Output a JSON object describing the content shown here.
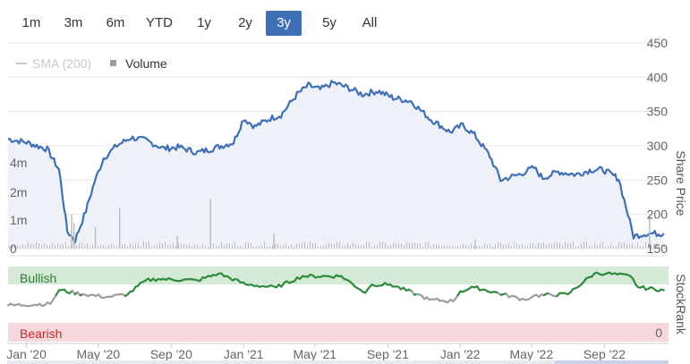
{
  "range_selector": {
    "buttons": [
      {
        "label": "1m",
        "active": false
      },
      {
        "label": "3m",
        "active": false
      },
      {
        "label": "6m",
        "active": false
      },
      {
        "label": "YTD",
        "active": false
      },
      {
        "label": "1y",
        "active": false
      },
      {
        "label": "2y",
        "active": false
      },
      {
        "label": "3y",
        "active": true
      },
      {
        "label": "5y",
        "active": false
      },
      {
        "label": "All",
        "active": false
      }
    ]
  },
  "colors": {
    "price_line": "#3f6fb5",
    "price_fill": "#eef1f8",
    "volume_bar": "#bdbdbd",
    "bullish_band": "#d4ead6",
    "bearish_band": "#f6d7dc",
    "rank_bullish": "#2e8b3e",
    "rank_neutral": "#9e9e9e",
    "active_button": "#3f70b4",
    "sma_legend": "#c8c8c8"
  },
  "chart_data": {
    "type": "line",
    "legend": {
      "placement": "top-left",
      "items": [
        {
          "label": "SMA (200)",
          "color": "#c8c8c8",
          "enabled": false
        },
        {
          "label": "Volume",
          "color": "#9e9e9e",
          "enabled": true
        }
      ]
    },
    "x_axis": {
      "ticks": [
        "Jan '20",
        "May '20",
        "Sep '20",
        "Jan '21",
        "May '21",
        "Sep '21",
        "Jan '22",
        "May '22",
        "Sep '22"
      ],
      "range": [
        "2019-12-01",
        "2022-12-15"
      ]
    },
    "price": {
      "axis_title": "Share Price",
      "axis_side": "right",
      "ylim": [
        150,
        450
      ],
      "ticks": [
        150,
        200,
        250,
        300,
        350,
        400,
        450
      ],
      "series": {
        "x": [
          "2019-12-01",
          "2020-01-01",
          "2020-02-05",
          "2020-02-25",
          "2020-03-10",
          "2020-03-23",
          "2020-04-10",
          "2020-04-25",
          "2020-05-10",
          "2020-06-01",
          "2020-06-25",
          "2020-07-20",
          "2020-08-20",
          "2020-09-15",
          "2020-10-15",
          "2020-11-10",
          "2020-12-15",
          "2021-01-01",
          "2021-01-20",
          "2021-02-15",
          "2021-03-05",
          "2021-04-01",
          "2021-04-20",
          "2021-05-10",
          "2021-06-01",
          "2021-06-25",
          "2021-07-20",
          "2021-08-15",
          "2021-09-10",
          "2021-10-10",
          "2021-11-10",
          "2021-12-15",
          "2022-01-05",
          "2022-01-25",
          "2022-02-20",
          "2022-03-10",
          "2022-04-10",
          "2022-05-05",
          "2022-05-20",
          "2022-06-15",
          "2022-07-15",
          "2022-08-10",
          "2022-08-30",
          "2022-09-25",
          "2022-10-20",
          "2022-11-10",
          "2022-12-10"
        ],
        "y": [
          310,
          305,
          295,
          265,
          175,
          162,
          205,
          248,
          282,
          300,
          312,
          308,
          296,
          298,
          290,
          296,
          305,
          340,
          328,
          340,
          345,
          375,
          388,
          382,
          392,
          385,
          375,
          380,
          370,
          365,
          340,
          320,
          330,
          316,
          285,
          250,
          258,
          268,
          253,
          262,
          258,
          265,
          265,
          252,
          168,
          172,
          172
        ]
      }
    },
    "volume": {
      "axis_side": "left",
      "ylim": [
        0,
        5
      ],
      "ticks": [
        "0",
        "1m",
        "2m",
        "4m"
      ],
      "bars": [
        {
          "x": "2020-03-16",
          "value": 1.6
        },
        {
          "x": "2020-03-20",
          "value": 1.2
        },
        {
          "x": "2020-04-25",
          "value": 1.0
        },
        {
          "x": "2020-06-05",
          "value": 1.9
        },
        {
          "x": "2020-09-10",
          "value": 0.6
        },
        {
          "x": "2020-11-05",
          "value": 2.3
        },
        {
          "x": "2021-02-20",
          "value": 0.7
        },
        {
          "x": "2022-01-25",
          "value": 0.4
        },
        {
          "x": "2022-11-15",
          "value": 1.5
        }
      ]
    },
    "stockrank": {
      "axis_title": "StockRank",
      "axis_side": "right",
      "ylim": [
        0,
        100
      ],
      "ticks": [
        "0"
      ],
      "band_labels": [
        "Bullish",
        "Bearish"
      ],
      "bullish_threshold": 80,
      "series": {
        "x": [
          "2019-12-01",
          "2020-02-10",
          "2020-02-25",
          "2020-04-05",
          "2020-05-15",
          "2020-06-20",
          "2020-07-20",
          "2020-08-10",
          "2020-10-15",
          "2020-11-20",
          "2021-01-05",
          "2021-02-25",
          "2021-04-10",
          "2021-06-15",
          "2021-07-25",
          "2021-08-05",
          "2021-09-05",
          "2021-10-20",
          "2021-11-10",
          "2021-12-20",
          "2022-01-01",
          "2022-01-25",
          "2022-04-20",
          "2022-05-05",
          "2022-07-01",
          "2022-08-15",
          "2022-09-05",
          "2022-10-15",
          "2022-10-28",
          "2022-12-10"
        ],
        "y": [
          72,
          73,
          83,
          80,
          78,
          80,
          90,
          91,
          90,
          95,
          87,
          85,
          93,
          93,
          81,
          87,
          87,
          80,
          76,
          75,
          82,
          85,
          76,
          79,
          80,
          95,
          95,
          93,
          85,
          83
        ]
      }
    }
  }
}
